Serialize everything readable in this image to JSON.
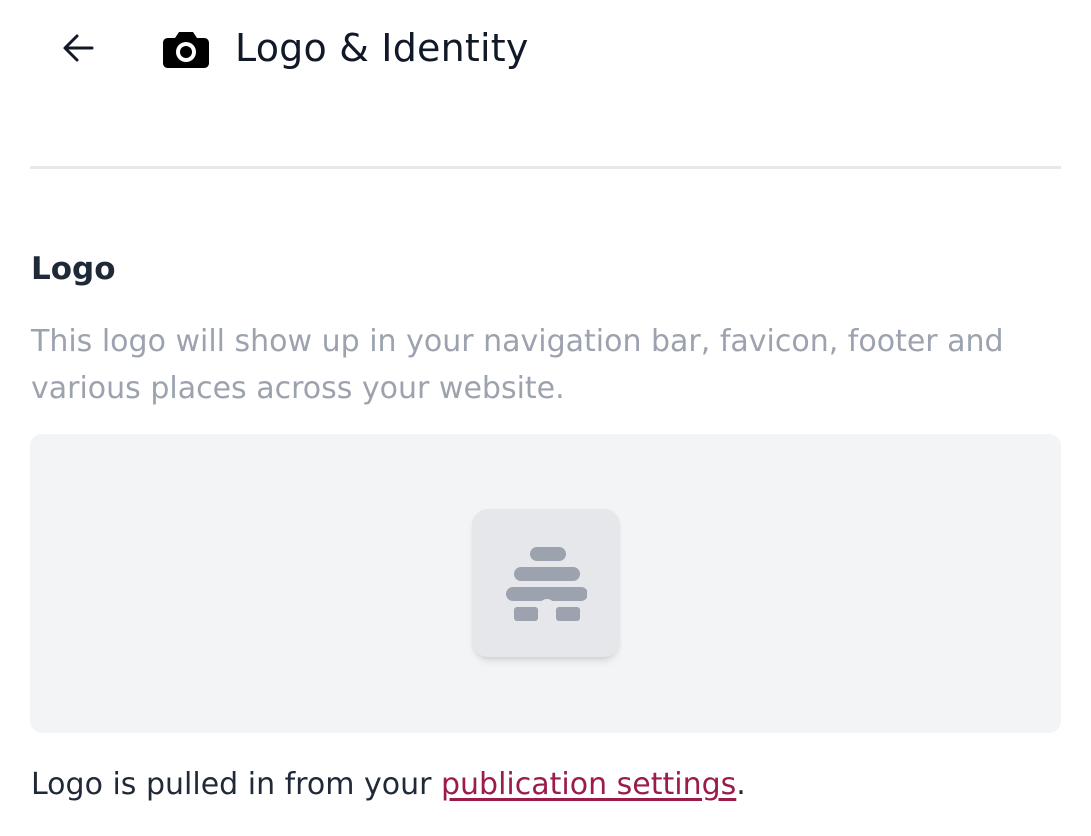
{
  "header": {
    "back_icon": "arrow-left-icon",
    "title_icon": "camera-icon",
    "title": "Logo & Identity"
  },
  "logo_section": {
    "title": "Logo",
    "description": "This logo will show up in your navigation bar, favicon, footer and various places across your website.",
    "placeholder_icon": "beehive-icon"
  },
  "footer": {
    "prefix": "Logo is pulled in from your ",
    "link_label": "publication settings",
    "suffix": "."
  },
  "colors": {
    "link": "#9b1c4c",
    "panel_background": "#f3f4f6",
    "placeholder_icon": "#9ca3af",
    "description_text": "#9ca3af"
  }
}
